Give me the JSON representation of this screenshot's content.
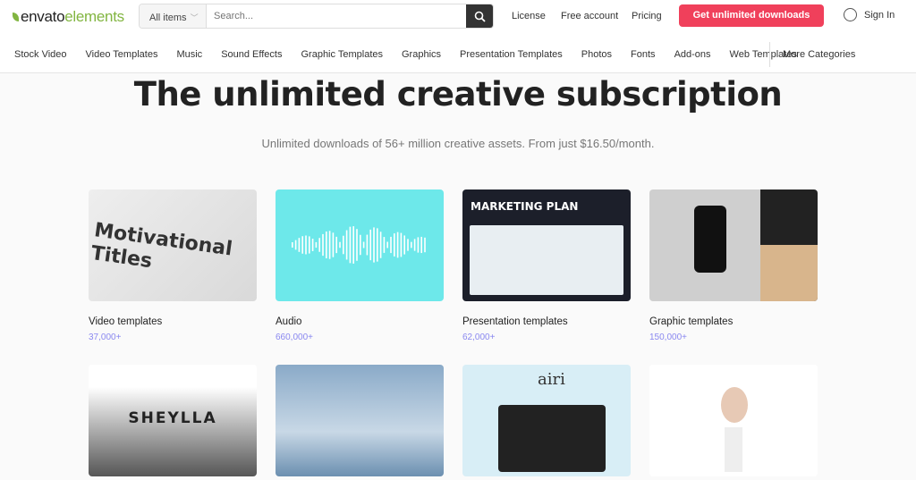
{
  "header": {
    "logo": {
      "part1": "envato",
      "part2": "elements"
    },
    "search": {
      "category": "All items",
      "placeholder": "Search..."
    },
    "links": [
      "License",
      "Free account",
      "Pricing"
    ],
    "cta": "Get unlimited downloads",
    "signin": "Sign In"
  },
  "nav": [
    "Stock Video",
    "Video Templates",
    "Music",
    "Sound Effects",
    "Graphic Templates",
    "Graphics",
    "Presentation Templates",
    "Photos",
    "Fonts",
    "Add-ons",
    "Web Templates"
  ],
  "more_categories": "More Categories",
  "hero": {
    "title": "The unlimited creative subscription",
    "subtitle": "Unlimited downloads of 56+ million creative assets. From just $16.50/month."
  },
  "cards": [
    {
      "title": "Video templates",
      "count": "37,000+",
      "thumb_text": "Motivational Titles"
    },
    {
      "title": "Audio",
      "count": "660,000+"
    },
    {
      "title": "Presentation templates",
      "count": "62,000+",
      "thumb_text": "MARKETING PLAN"
    },
    {
      "title": "Graphic templates",
      "count": "150,000+"
    }
  ],
  "row2": [
    {
      "thumb_text": "SHEYLLA"
    },
    {},
    {
      "thumb_text": "airi"
    },
    {}
  ],
  "colors": {
    "accent": "#f0405b",
    "brand": "#82b541",
    "count": "#8a88f0"
  }
}
